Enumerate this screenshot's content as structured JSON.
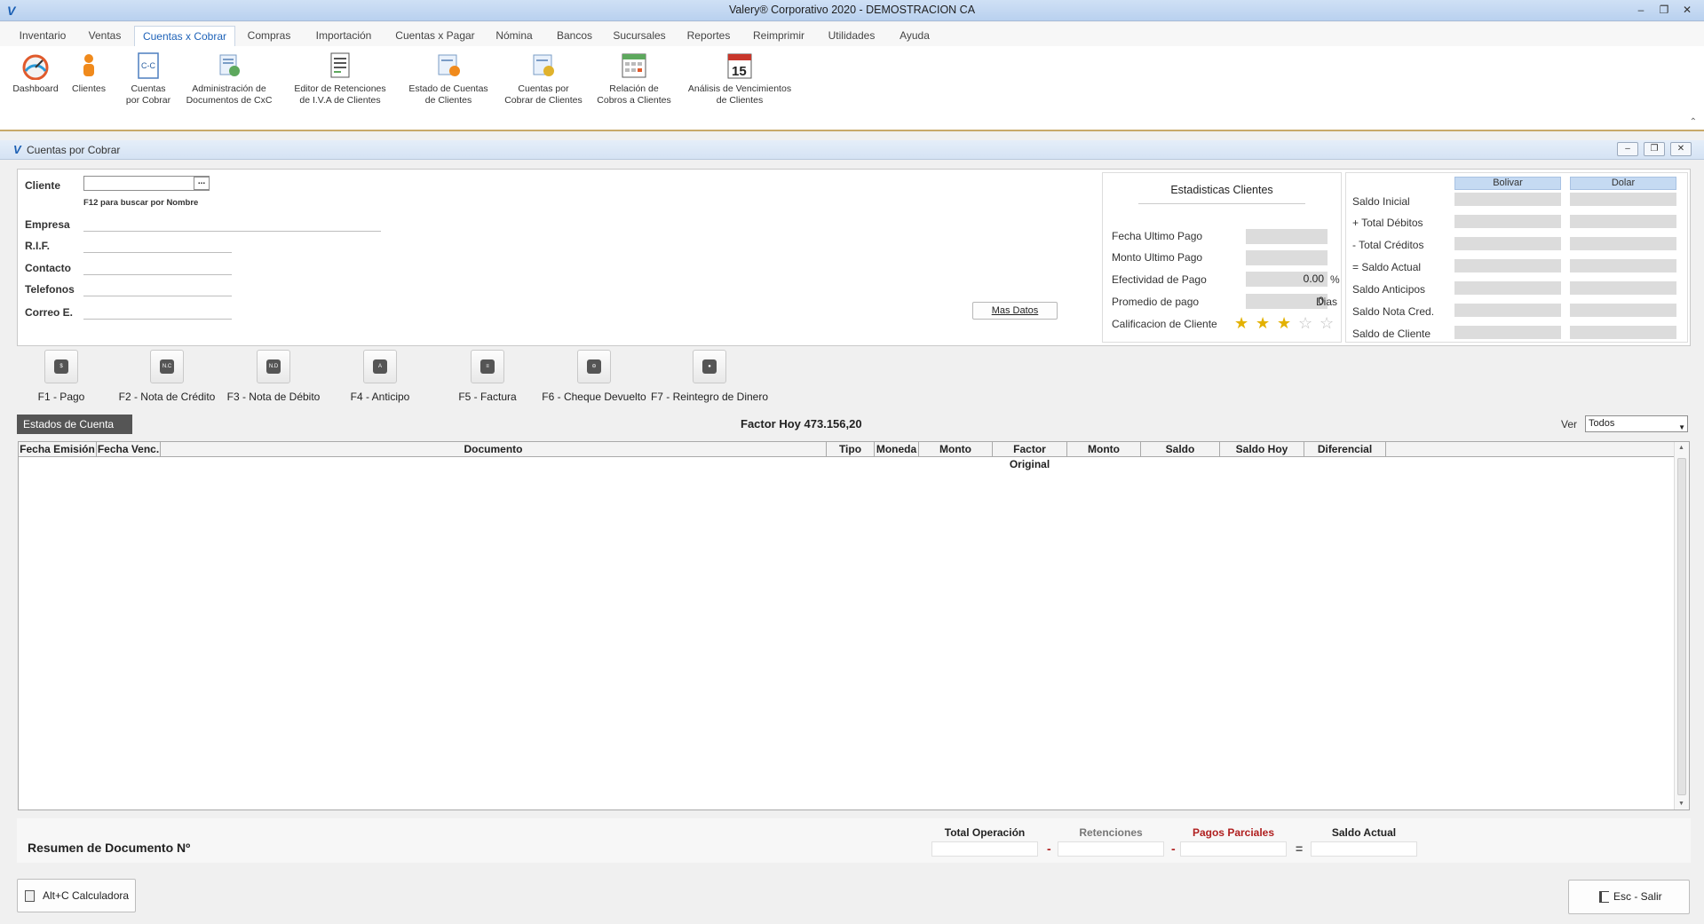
{
  "window": {
    "title": "Valery® Corporativo 2020 - DEMOSTRACION CA"
  },
  "menu": {
    "tabs": [
      "Inventario",
      "Ventas",
      "Cuentas x Cobrar",
      "Compras",
      "Importación",
      "Cuentas x Pagar",
      "Nómina",
      "Bancos",
      "Sucursales",
      "Reportes",
      "Reimprimir",
      "Utilidades",
      "Ayuda"
    ],
    "active": "Cuentas x Cobrar"
  },
  "ribbon": [
    {
      "l1": "Dashboard",
      "l2": "",
      "icon": "gauge-icon"
    },
    {
      "l1": "Clientes",
      "l2": "",
      "icon": "person-icon"
    },
    {
      "l1": "Cuentas",
      "l2": "por Cobrar",
      "icon": "cxc-doc-icon"
    },
    {
      "l1": "Administración de",
      "l2": "Documentos de CxC",
      "icon": "doc-admin-icon"
    },
    {
      "l1": "Editor de Retenciones",
      "l2": "de I.V.A de Clientes",
      "icon": "retention-editor-icon"
    },
    {
      "l1": "Estado de Cuentas",
      "l2": "de Clientes",
      "icon": "account-statement-icon"
    },
    {
      "l1": "Cuentas por",
      "l2": "Cobrar de Clientes",
      "icon": "receivables-icon"
    },
    {
      "l1": "Relación de",
      "l2": "Cobros a Clientes",
      "icon": "calendar-grid-icon"
    },
    {
      "l1": "Análisis de Vencimientos",
      "l2": "de Clientes",
      "icon": "calendar-15-icon",
      "badge": "15"
    }
  ],
  "child_window": {
    "title": "Cuentas por Cobrar"
  },
  "client": {
    "cliente_label": "Cliente",
    "cliente_value": "",
    "dots": "...",
    "hint": "F12 para buscar por Nombre",
    "empresa_label": "Empresa",
    "rif_label": "R.I.F.",
    "contacto_label": "Contacto",
    "telefonos_label": "Telefonos",
    "correo_label": "Correo E.",
    "mas_datos": "Mas Datos"
  },
  "stats": {
    "title": "Estadisticas Clientes",
    "fecha_ultimo_pago": "Fecha Ultimo Pago",
    "monto_ultimo_pago": "Monto Ultimo Pago",
    "efectividad_label": "Efectividad de Pago",
    "efectividad_value": "0.00",
    "efectividad_unit": "%",
    "promedio_label": "Promedio de pago",
    "promedio_value": "0",
    "promedio_unit": "Dias",
    "calificacion_label": "Calificacion de Cliente",
    "rating": 3,
    "rating_max": 5
  },
  "balances": {
    "col_bolivar": "Bolivar",
    "col_dolar": "Dolar",
    "rows": [
      "Saldo Inicial",
      "+ Total Débitos",
      "- Total Créditos",
      "= Saldo Actual",
      "Saldo Anticipos",
      "Saldo Nota Cred.",
      "Saldo de Cliente"
    ]
  },
  "functions": [
    {
      "label": "F1 - Pago",
      "icon": "payment-icon",
      "glyph": "$"
    },
    {
      "label": "F2 - Nota de Crédito",
      "icon": "credit-note-icon",
      "glyph": "N.C"
    },
    {
      "label": "F3 - Nota de Débito",
      "icon": "debit-note-icon",
      "glyph": "N.D"
    },
    {
      "label": "F4 - Anticipo",
      "icon": "advance-icon",
      "glyph": "A"
    },
    {
      "label": "F5 - Factura",
      "icon": "invoice-icon",
      "glyph": "≡"
    },
    {
      "label": "F6 - Cheque Devuelto",
      "icon": "returned-check-icon",
      "glyph": "⊖"
    },
    {
      "label": "F7 - Reintegro de Dinero",
      "icon": "refund-icon",
      "glyph": "●"
    }
  ],
  "statement": {
    "tab": "Estados de Cuenta",
    "factor": "Factor Hoy  473.156,20",
    "ver_label": "Ver",
    "ver_value": "Todos"
  },
  "grid": {
    "columns": [
      "Fecha Emisión",
      "Fecha Venc.",
      "Documento",
      "Tipo",
      "Moneda",
      "Monto",
      "Factor Original",
      "Monto",
      "Saldo",
      "Saldo Hoy",
      "Diferencial"
    ],
    "rows": []
  },
  "summary": {
    "title": "Resumen de Documento Nº",
    "total_operacion": "Total Operación",
    "retenciones": "Retenciones",
    "pagos_parciales": "Pagos Parciales",
    "saldo_actual": "Saldo Actual",
    "minus": "-",
    "equals": "="
  },
  "buttons": {
    "calculadora": "Alt+C Calculadora",
    "salir": "Esc - Salir"
  },
  "colors": {
    "accent_blue": "#1e62b8",
    "balance_header": "#c5daf2",
    "pagos_parciales": "#b02020",
    "star_full": "#e3b100"
  }
}
